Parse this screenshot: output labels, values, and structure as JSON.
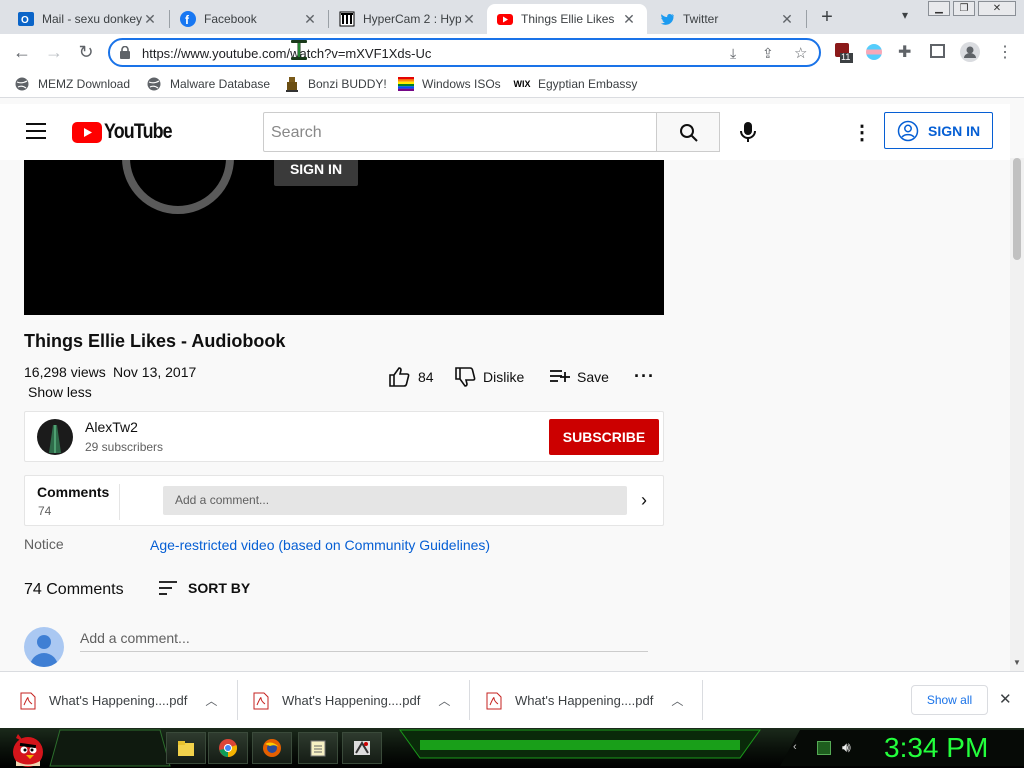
{
  "browser": {
    "tabs": [
      {
        "title": "Mail - sexu donkey",
        "icon": "outlook-icon"
      },
      {
        "title": "Facebook",
        "icon": "facebook-icon"
      },
      {
        "title": "HyperCam 2 : Hyp",
        "icon": "archive-icon"
      },
      {
        "title": "Things Ellie Likes",
        "icon": "youtube-icon",
        "active": true
      },
      {
        "title": "Twitter",
        "icon": "twitter-icon"
      }
    ],
    "new_tab": "+",
    "url": "https://www.youtube.com/watch?v=mXVF1Xds-Uc",
    "extension_badge": "11",
    "bookmarks": [
      {
        "label": "MEMZ Download",
        "icon": "globe-icon"
      },
      {
        "label": "Malware Database",
        "icon": "globe-icon"
      },
      {
        "label": "Bonzi BUDDY!",
        "icon": "bonzi-icon"
      },
      {
        "label": "Windows ISOs",
        "icon": "windows-icon"
      },
      {
        "label": "Egyptian Embassy",
        "icon": "wix-icon"
      }
    ]
  },
  "youtube": {
    "logo": "YouTube",
    "search_placeholder": "Search",
    "header_sign_in": "SIGN IN",
    "overlay_sign_in": "SIGN IN",
    "video_title": "Things Ellie Likes - Audiobook",
    "views": "16,298 views",
    "date": "Nov 13, 2017",
    "show_less": "Show less",
    "likes": "84",
    "dislike": "Dislike",
    "save": "Save",
    "channel_name": "AlexTw2",
    "subscribers": "29 subscribers",
    "subscribe": "SUBSCRIBE",
    "comments_label": "Comments",
    "comments_count": "74",
    "add_comment_placeholder": "Add a comment...",
    "notice_label": "Notice",
    "notice_value": "Age-restricted video (based on Community Guidelines)",
    "comments_total": "74 Comments",
    "sort_by": "SORT BY",
    "add_comment_placeholder2": "Add a comment..."
  },
  "downloads": {
    "items": [
      "What's Happening....pdf",
      "What's Happening....pdf",
      "What's Happening....pdf"
    ],
    "show_all": "Show all"
  },
  "taskbar": {
    "clock": "3:34 PM"
  },
  "colors": {
    "accent_blue": "#1a73e8",
    "youtube_red": "#ff0000",
    "subscribe_red": "#cc0000",
    "link_blue": "#065fd4",
    "clock_green": "#23ff3c"
  }
}
